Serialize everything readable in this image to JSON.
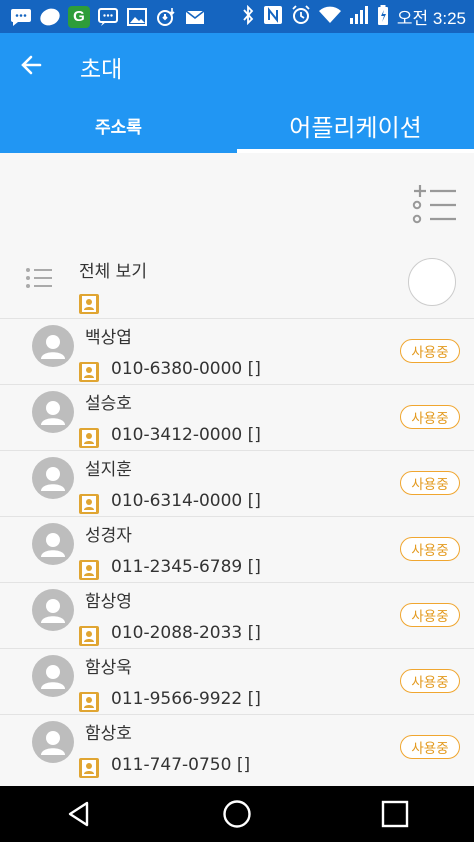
{
  "status_bar": {
    "icons": [
      "sms-icon",
      "app-bubble-icon",
      "g-app-icon",
      "chat-icon",
      "image-icon",
      "alarm-download-icon",
      "mail-icon",
      "bluetooth-icon",
      "nfc-icon",
      "alarm-clock-icon",
      "wifi-icon",
      "signal-icon",
      "battery-icon"
    ],
    "g_label": "G",
    "time": "오전 3:25"
  },
  "app_bar": {
    "title": "초대",
    "tabs": [
      {
        "label": "주소록",
        "active": false
      },
      {
        "label": "어플리케이션",
        "active": true
      }
    ],
    "color": "#2196f3"
  },
  "select_all": {
    "label": "전체 보기"
  },
  "contacts": [
    {
      "name": "백상엽",
      "phone": "010-6380-0000 []",
      "status": "사용중"
    },
    {
      "name": "설승호",
      "phone": "010-3412-0000 []",
      "status": "사용중"
    },
    {
      "name": "설지훈",
      "phone": "010-6314-0000 []",
      "status": "사용중"
    },
    {
      "name": "성경자",
      "phone": "011-2345-6789 []",
      "status": "사용중"
    },
    {
      "name": "함상영",
      "phone": "010-2088-2033 []",
      "status": "사용중"
    },
    {
      "name": "함상욱",
      "phone": "011-9566-9922 []",
      "status": "사용중"
    },
    {
      "name": "함상호",
      "phone": "011-747-0750 []",
      "status": "사용중"
    }
  ],
  "nav_bar": {
    "icons": [
      "back-triangle-icon",
      "home-circle-icon",
      "recents-square-icon"
    ]
  },
  "colors": {
    "status_bar": "#1565c0",
    "accent": "#2196f3",
    "badge": "#f0a630"
  }
}
